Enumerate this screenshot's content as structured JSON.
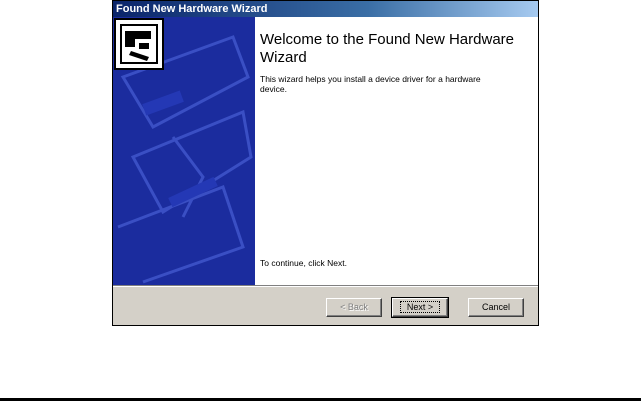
{
  "window": {
    "title": "Found New Hardware Wizard"
  },
  "sidebar": {
    "icon": "hardware-board-icon",
    "background_color": "#1b2c9e"
  },
  "main": {
    "heading": "Welcome to the Found New Hardware Wizard",
    "description": "This wizard helps you install a device driver for a hardware device.",
    "continue_text": "To continue, click Next."
  },
  "buttons": {
    "back": "< Back",
    "next": "Next >",
    "cancel": "Cancel"
  }
}
